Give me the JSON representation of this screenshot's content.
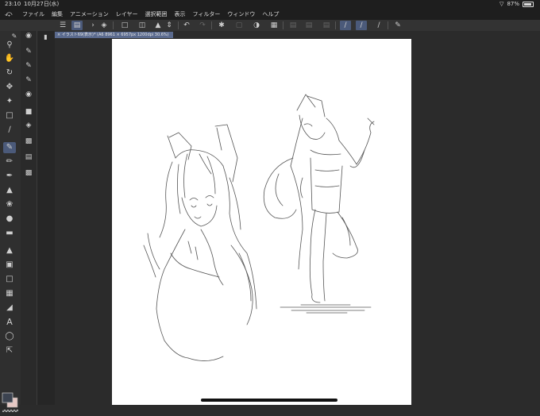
{
  "status": {
    "time": "23:10",
    "date": "10月27日(水)",
    "battery": "87%",
    "battery_level": 0.87
  },
  "menu": {
    "items": [
      "ファイル",
      "編集",
      "アニメーション",
      "レイヤー",
      "選択範囲",
      "表示",
      "フィルター",
      "ウィンドウ",
      "ヘルプ"
    ]
  },
  "document": {
    "tab_title": "イラスト69(表示)* (A6 8961 × 6957px 1200dpi 30.6%)"
  },
  "icons": {
    "app": "clip-studio-logo-icon",
    "tools": [
      "brush-size-icon",
      "zoom-icon",
      "hand-icon",
      "rotate-icon",
      "move-icon",
      "auto-select-icon",
      "select-rect-icon",
      "eyedropper-icon",
      "pen-icon",
      "pencil-icon",
      "brush-icon",
      "airbrush-icon",
      "decoration-icon",
      "blend-icon",
      "eraser-icon",
      "fill-icon",
      "gradient-icon",
      "figure-icon",
      "frame-icon",
      "ruler-icon",
      "text-icon",
      "balloon-icon",
      "correct-line-icon"
    ]
  },
  "colors": {
    "accent": "#4b5a7a",
    "main_color": "#3c4350",
    "sub_color": "#e6c8c4"
  }
}
